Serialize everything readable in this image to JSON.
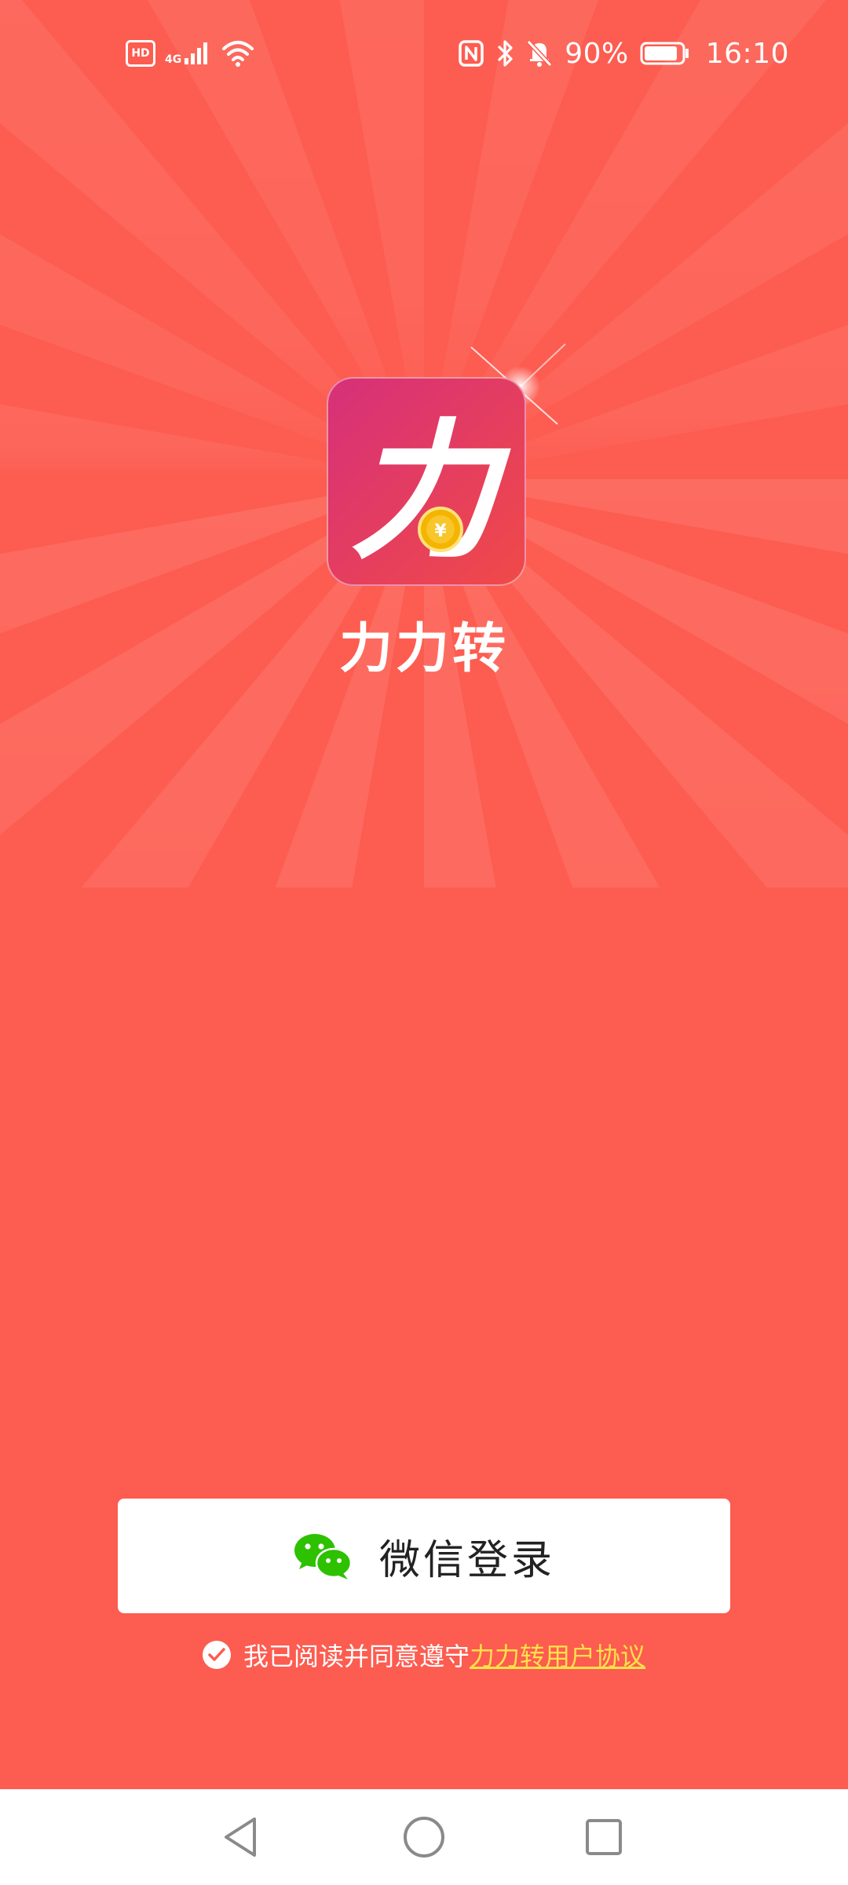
{
  "status_bar": {
    "hd_label": "HD",
    "network_label": "4G",
    "battery_percent": "90%",
    "battery_level": 0.9,
    "time": "16:10",
    "icons": [
      "hd-icon",
      "signal-icon",
      "wifi-icon",
      "nfc-icon",
      "bluetooth-icon",
      "mute-bell-icon",
      "battery-icon"
    ]
  },
  "app": {
    "name": "力力转",
    "icon_glyph": "力",
    "coin_glyph": "¥"
  },
  "login": {
    "button_label": "微信登录",
    "icon": "wechat-icon"
  },
  "agreement": {
    "checked": true,
    "text": "我已阅读并同意遵守",
    "link_text": "力力转用户协议"
  },
  "nav": {
    "back": "back-triangle-icon",
    "home": "home-circle-icon",
    "recents": "recents-square-icon"
  },
  "colors": {
    "background": "#FD5C50",
    "link": "#FFE14A",
    "button_bg": "#FFFFFF",
    "wechat_green": "#2DC100"
  }
}
